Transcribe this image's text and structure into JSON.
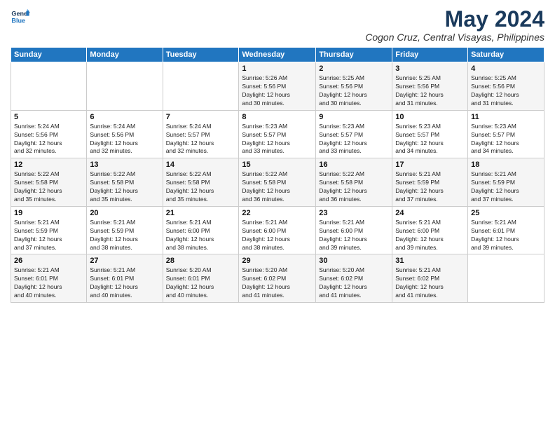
{
  "logo": {
    "line1": "General",
    "line2": "Blue"
  },
  "title": "May 2024",
  "location": "Cogon Cruz, Central Visayas, Philippines",
  "days_of_week": [
    "Sunday",
    "Monday",
    "Tuesday",
    "Wednesday",
    "Thursday",
    "Friday",
    "Saturday"
  ],
  "weeks": [
    [
      {
        "day": "",
        "info": ""
      },
      {
        "day": "",
        "info": ""
      },
      {
        "day": "",
        "info": ""
      },
      {
        "day": "1",
        "info": "Sunrise: 5:26 AM\nSunset: 5:56 PM\nDaylight: 12 hours\nand 30 minutes."
      },
      {
        "day": "2",
        "info": "Sunrise: 5:25 AM\nSunset: 5:56 PM\nDaylight: 12 hours\nand 30 minutes."
      },
      {
        "day": "3",
        "info": "Sunrise: 5:25 AM\nSunset: 5:56 PM\nDaylight: 12 hours\nand 31 minutes."
      },
      {
        "day": "4",
        "info": "Sunrise: 5:25 AM\nSunset: 5:56 PM\nDaylight: 12 hours\nand 31 minutes."
      }
    ],
    [
      {
        "day": "5",
        "info": "Sunrise: 5:24 AM\nSunset: 5:56 PM\nDaylight: 12 hours\nand 32 minutes."
      },
      {
        "day": "6",
        "info": "Sunrise: 5:24 AM\nSunset: 5:56 PM\nDaylight: 12 hours\nand 32 minutes."
      },
      {
        "day": "7",
        "info": "Sunrise: 5:24 AM\nSunset: 5:57 PM\nDaylight: 12 hours\nand 32 minutes."
      },
      {
        "day": "8",
        "info": "Sunrise: 5:23 AM\nSunset: 5:57 PM\nDaylight: 12 hours\nand 33 minutes."
      },
      {
        "day": "9",
        "info": "Sunrise: 5:23 AM\nSunset: 5:57 PM\nDaylight: 12 hours\nand 33 minutes."
      },
      {
        "day": "10",
        "info": "Sunrise: 5:23 AM\nSunset: 5:57 PM\nDaylight: 12 hours\nand 34 minutes."
      },
      {
        "day": "11",
        "info": "Sunrise: 5:23 AM\nSunset: 5:57 PM\nDaylight: 12 hours\nand 34 minutes."
      }
    ],
    [
      {
        "day": "12",
        "info": "Sunrise: 5:22 AM\nSunset: 5:58 PM\nDaylight: 12 hours\nand 35 minutes."
      },
      {
        "day": "13",
        "info": "Sunrise: 5:22 AM\nSunset: 5:58 PM\nDaylight: 12 hours\nand 35 minutes."
      },
      {
        "day": "14",
        "info": "Sunrise: 5:22 AM\nSunset: 5:58 PM\nDaylight: 12 hours\nand 35 minutes."
      },
      {
        "day": "15",
        "info": "Sunrise: 5:22 AM\nSunset: 5:58 PM\nDaylight: 12 hours\nand 36 minutes."
      },
      {
        "day": "16",
        "info": "Sunrise: 5:22 AM\nSunset: 5:58 PM\nDaylight: 12 hours\nand 36 minutes."
      },
      {
        "day": "17",
        "info": "Sunrise: 5:21 AM\nSunset: 5:59 PM\nDaylight: 12 hours\nand 37 minutes."
      },
      {
        "day": "18",
        "info": "Sunrise: 5:21 AM\nSunset: 5:59 PM\nDaylight: 12 hours\nand 37 minutes."
      }
    ],
    [
      {
        "day": "19",
        "info": "Sunrise: 5:21 AM\nSunset: 5:59 PM\nDaylight: 12 hours\nand 37 minutes."
      },
      {
        "day": "20",
        "info": "Sunrise: 5:21 AM\nSunset: 5:59 PM\nDaylight: 12 hours\nand 38 minutes."
      },
      {
        "day": "21",
        "info": "Sunrise: 5:21 AM\nSunset: 6:00 PM\nDaylight: 12 hours\nand 38 minutes."
      },
      {
        "day": "22",
        "info": "Sunrise: 5:21 AM\nSunset: 6:00 PM\nDaylight: 12 hours\nand 38 minutes."
      },
      {
        "day": "23",
        "info": "Sunrise: 5:21 AM\nSunset: 6:00 PM\nDaylight: 12 hours\nand 39 minutes."
      },
      {
        "day": "24",
        "info": "Sunrise: 5:21 AM\nSunset: 6:00 PM\nDaylight: 12 hours\nand 39 minutes."
      },
      {
        "day": "25",
        "info": "Sunrise: 5:21 AM\nSunset: 6:01 PM\nDaylight: 12 hours\nand 39 minutes."
      }
    ],
    [
      {
        "day": "26",
        "info": "Sunrise: 5:21 AM\nSunset: 6:01 PM\nDaylight: 12 hours\nand 40 minutes."
      },
      {
        "day": "27",
        "info": "Sunrise: 5:21 AM\nSunset: 6:01 PM\nDaylight: 12 hours\nand 40 minutes."
      },
      {
        "day": "28",
        "info": "Sunrise: 5:20 AM\nSunset: 6:01 PM\nDaylight: 12 hours\nand 40 minutes."
      },
      {
        "day": "29",
        "info": "Sunrise: 5:20 AM\nSunset: 6:02 PM\nDaylight: 12 hours\nand 41 minutes."
      },
      {
        "day": "30",
        "info": "Sunrise: 5:20 AM\nSunset: 6:02 PM\nDaylight: 12 hours\nand 41 minutes."
      },
      {
        "day": "31",
        "info": "Sunrise: 5:21 AM\nSunset: 6:02 PM\nDaylight: 12 hours\nand 41 minutes."
      },
      {
        "day": "",
        "info": ""
      }
    ]
  ]
}
